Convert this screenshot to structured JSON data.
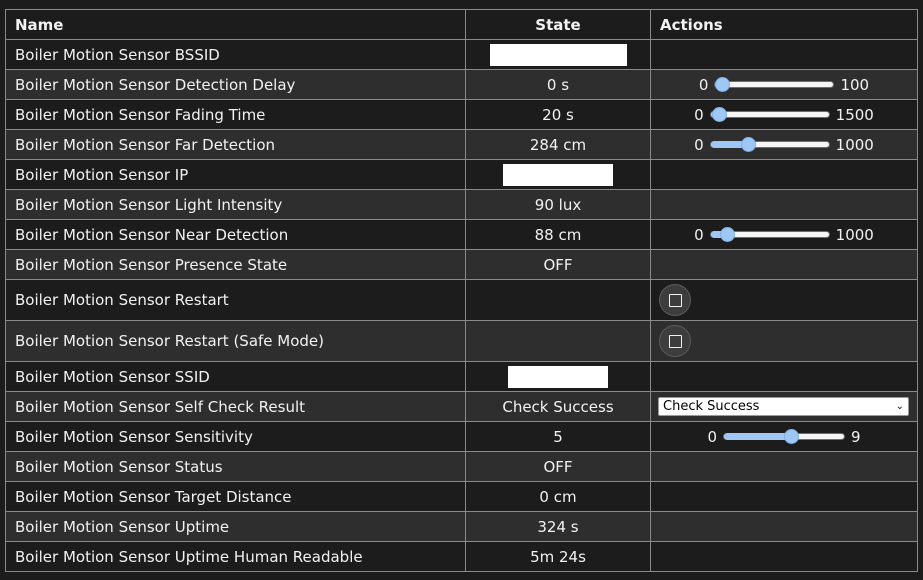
{
  "headers": {
    "name": "Name",
    "state": "State",
    "actions": "Actions"
  },
  "colors": {
    "row_dark": "#1c1c1c",
    "row_light": "#2e2e2e",
    "border": "#8a8a8a",
    "slider_accent": "#9fc7f5"
  },
  "rows": [
    {
      "name": "Boiler Motion Sensor BSSID",
      "state": "",
      "state_redacted": true
    },
    {
      "name": "Boiler Motion Sensor Detection Delay",
      "state": "0 s",
      "slider": {
        "min": "0",
        "max": "100",
        "value": 0
      }
    },
    {
      "name": "Boiler Motion Sensor Fading Time",
      "state": "20 s",
      "slider": {
        "min": "0",
        "max": "1500",
        "value": 20
      }
    },
    {
      "name": "Boiler Motion Sensor Far Detection",
      "state": "284 cm",
      "slider": {
        "min": "0",
        "max": "1000",
        "value": 284
      }
    },
    {
      "name": "Boiler Motion Sensor IP",
      "state": "",
      "state_redacted": true
    },
    {
      "name": "Boiler Motion Sensor Light Intensity",
      "state": "90 lux"
    },
    {
      "name": "Boiler Motion Sensor Near Detection",
      "state": "88 cm",
      "slider": {
        "min": "0",
        "max": "1000",
        "value": 88
      }
    },
    {
      "name": "Boiler Motion Sensor Presence State",
      "state": "OFF"
    },
    {
      "name": "Boiler Motion Sensor Restart",
      "state": "",
      "button_icon": "stop-square-icon"
    },
    {
      "name": "Boiler Motion Sensor Restart (Safe Mode)",
      "state": "",
      "button_icon": "stop-square-icon"
    },
    {
      "name": "Boiler Motion Sensor SSID",
      "state": "",
      "state_redacted": true
    },
    {
      "name": "Boiler Motion Sensor Self Check Result",
      "state": "Check Success",
      "select": {
        "value": "Check Success",
        "icon": "chevron-down-icon"
      }
    },
    {
      "name": "Boiler Motion Sensor Sensitivity",
      "state": "5",
      "slider": {
        "min": "0",
        "max": "9",
        "value": 5
      }
    },
    {
      "name": "Boiler Motion Sensor Status",
      "state": "OFF"
    },
    {
      "name": "Boiler Motion Sensor Target Distance",
      "state": "0 cm"
    },
    {
      "name": "Boiler Motion Sensor Uptime",
      "state": "324 s"
    },
    {
      "name": "Boiler Motion Sensor Uptime Human Readable",
      "state": "5m 24s"
    }
  ]
}
